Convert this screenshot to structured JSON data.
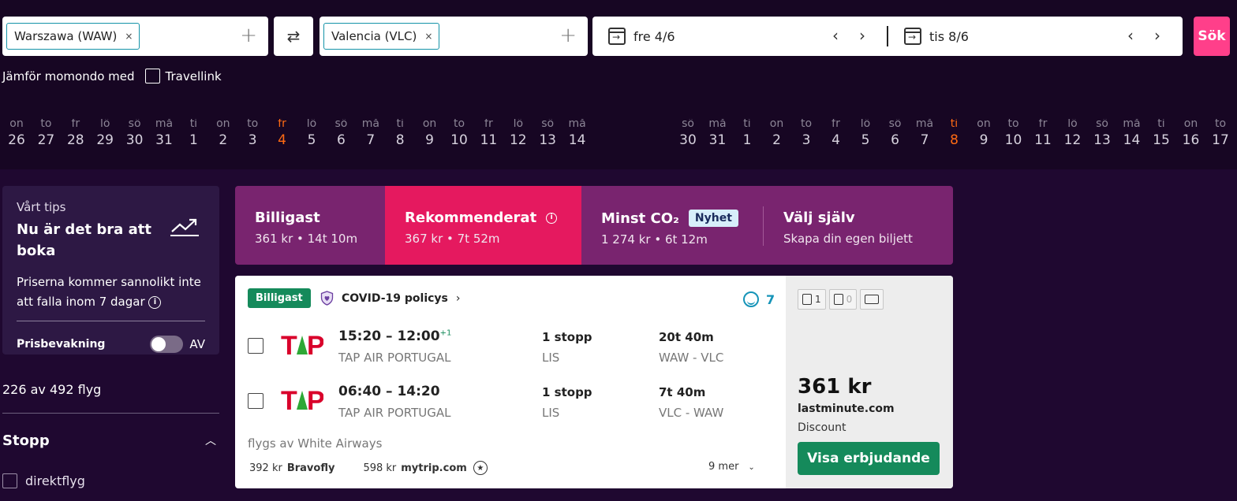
{
  "search": {
    "origin": "Warszawa (WAW)",
    "destination": "Valencia (VLC)",
    "chip_remove": "×",
    "add_symbol": "+",
    "swap_symbol": "⇄",
    "depart_date": "fre 4/6",
    "return_date": "tis 8/6",
    "prev_symbol": "‹",
    "next_symbol": "›",
    "search_button": "Sök"
  },
  "compare": {
    "label": "Jämför momondo med",
    "option": "Travellink"
  },
  "depart_strip": [
    {
      "wd": "on",
      "d": "26"
    },
    {
      "wd": "to",
      "d": "27"
    },
    {
      "wd": "fr",
      "d": "28"
    },
    {
      "wd": "lö",
      "d": "29"
    },
    {
      "wd": "sö",
      "d": "30"
    },
    {
      "wd": "må",
      "d": "31"
    },
    {
      "wd": "ti",
      "d": "1"
    },
    {
      "wd": "on",
      "d": "2"
    },
    {
      "wd": "to",
      "d": "3"
    },
    {
      "wd": "fr",
      "d": "4",
      "selected": true
    },
    {
      "wd": "lö",
      "d": "5"
    },
    {
      "wd": "sö",
      "d": "6"
    },
    {
      "wd": "må",
      "d": "7"
    },
    {
      "wd": "ti",
      "d": "8"
    },
    {
      "wd": "on",
      "d": "9"
    },
    {
      "wd": "to",
      "d": "10"
    },
    {
      "wd": "fr",
      "d": "11"
    },
    {
      "wd": "lö",
      "d": "12"
    },
    {
      "wd": "sö",
      "d": "13"
    },
    {
      "wd": "må",
      "d": "14"
    }
  ],
  "return_strip": [
    {
      "wd": "sö",
      "d": "30"
    },
    {
      "wd": "må",
      "d": "31"
    },
    {
      "wd": "ti",
      "d": "1"
    },
    {
      "wd": "on",
      "d": "2"
    },
    {
      "wd": "to",
      "d": "3"
    },
    {
      "wd": "fr",
      "d": "4"
    },
    {
      "wd": "lö",
      "d": "5"
    },
    {
      "wd": "sö",
      "d": "6"
    },
    {
      "wd": "må",
      "d": "7"
    },
    {
      "wd": "ti",
      "d": "8",
      "selected": true
    },
    {
      "wd": "on",
      "d": "9"
    },
    {
      "wd": "to",
      "d": "10"
    },
    {
      "wd": "fr",
      "d": "11"
    },
    {
      "wd": "lö",
      "d": "12"
    },
    {
      "wd": "sö",
      "d": "13"
    },
    {
      "wd": "må",
      "d": "14"
    },
    {
      "wd": "ti",
      "d": "15"
    },
    {
      "wd": "on",
      "d": "16"
    },
    {
      "wd": "to",
      "d": "17"
    }
  ],
  "tip": {
    "label": "Vårt tips",
    "headline": "Nu är det bra att boka",
    "description": "Priserna kommer sannolikt inte att falla inom 7 dagar",
    "info_symbol": "i",
    "alert_label": "Prisbevakning",
    "alert_state": "AV"
  },
  "filters": {
    "count": "226 av 492 flyg",
    "stops_title": "Stopp",
    "caret_symbol": "︿",
    "direct_label": "direktflyg"
  },
  "tabs": [
    {
      "title": "Billigast",
      "sub": "361 kr • 14t 10m"
    },
    {
      "title": "Rekommenderat",
      "sub": "367 kr • 7t 52m",
      "active": true
    },
    {
      "title": "Minst CO₂",
      "sub": "1 274 kr • 6t 12m",
      "badge": "Nyhet"
    },
    {
      "title": "Välj själv",
      "sub": "Skapa din egen biljett"
    }
  ],
  "result": {
    "badge": "Billigast",
    "covid": "COVID-19 policys",
    "arrow": "›",
    "rating": "7",
    "flights": [
      {
        "time": "15:20 – 12:00",
        "plus": "+1",
        "airline": "TAP AIR PORTUGAL",
        "stops": "1 stopp",
        "via": "LIS",
        "duration": "20t 40m",
        "route": "WAW - VLC"
      },
      {
        "time": "06:40 – 14:20",
        "plus": "",
        "airline": "TAP AIR PORTUGAL",
        "stops": "1 stopp",
        "via": "LIS",
        "duration": "7t 40m",
        "route": "VLC - WAW"
      }
    ],
    "operated_by": "flygs av White Airways",
    "providers": [
      {
        "price": "392 kr",
        "name": "Bravofly"
      },
      {
        "price": "598 kr",
        "name": "mytrip.com"
      }
    ],
    "more": "9 mer",
    "more_caret": "⌄",
    "bags": {
      "carry_on": "1",
      "checked": "0"
    },
    "price": "361 kr",
    "site": "lastminute.com",
    "plan": "Discount",
    "deal_button": "Visa erbjudande"
  },
  "colors": {
    "accent_pink": "#e5195f",
    "search_pink": "#ff3f8a",
    "tabs_purple": "#79246f",
    "green": "#158a5b",
    "selected_day": "#ff6a13"
  }
}
